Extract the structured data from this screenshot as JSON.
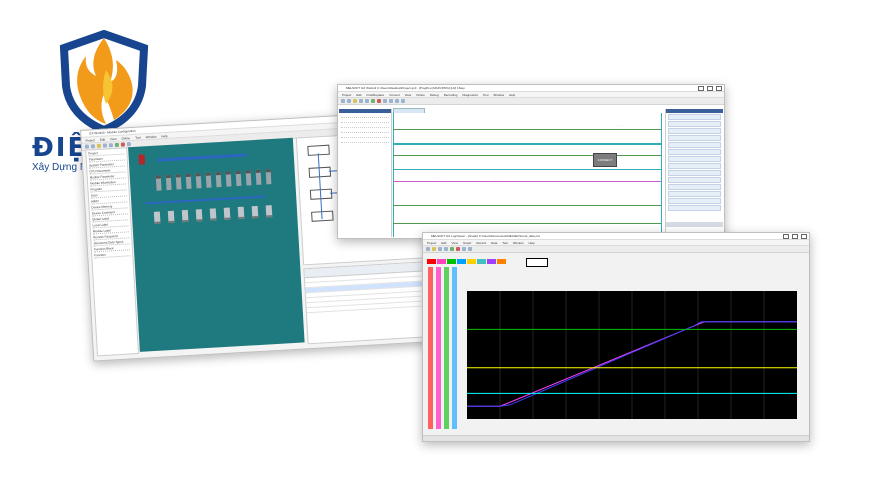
{
  "brand": {
    "name": "ĐIỆN NĂNG",
    "tagline": "Xây Dựng Niềm Tin Bằng Chất Lượng",
    "colors": {
      "blue": "#17458f",
      "flame_orange": "#f29a1a",
      "flame_yellow": "#f7c531"
    }
  },
  "windows": {
    "configurator": {
      "title": "GX Works3 - Module Configuration",
      "menu": [
        "Project",
        "Edit",
        "View",
        "Online",
        "Tool",
        "Window",
        "Help"
      ],
      "tree_items": [
        "Project",
        "Parameter",
        "System Parameter",
        "CPU Parameter",
        "Module Parameter",
        "Module Information",
        "Program",
        "Scan",
        "MAIN",
        "Device Memory",
        "Device Comment",
        "Global Label",
        "Local Label",
        "Module Label",
        "Remote Password",
        "Structured Data Types",
        "Function Block",
        "Function"
      ],
      "tab": "Module Configuration",
      "accent": "#1e7a7e"
    },
    "ladder": {
      "title": "MELSOFT GX Works3 C:\\Users\\Desktop\\Project.gx3 - [ProgPou] MAIN [PRG] [LD] 1Step",
      "menu": [
        "Project",
        "Edit",
        "Find/Replace",
        "Convert",
        "View",
        "Online",
        "Debug",
        "Recording",
        "Diagnostics",
        "Tool",
        "Window",
        "Help"
      ],
      "tabs": [
        "ProgPou [PRG] [LD]"
      ],
      "panel_navigation": "Navigation",
      "panel_elements": "Element Selection",
      "elements": [
        "Function Block",
        "Function",
        "Constant",
        "Structured Data",
        "Standard Function",
        "Standard FB",
        "Simulation",
        "Comparison",
        "Counter",
        "Timer",
        "Logical Op",
        "Data Transfer",
        "Program Control",
        "Output",
        "Special",
        "Math"
      ],
      "coil_label": "CONNECT",
      "rail_color": "#2fb0b8"
    },
    "trend": {
      "title": "MELSOFT GX LogViewer - [Graph] C:\\Users\\Documents\\MELSEC\\trend_data.csv",
      "menu": [
        "Project",
        "Edit",
        "View",
        "Graph",
        "Record",
        "Data",
        "Tool",
        "Window",
        "Help"
      ],
      "chip_colors": [
        "#ff0000",
        "#ff40c0",
        "#00c000",
        "#00a0ff",
        "#ffd000",
        "#40c0c0",
        "#a040ff",
        "#ff8000"
      ],
      "plot_bg": "#000000",
      "status": "Ready"
    }
  },
  "chart_data": {
    "type": "line",
    "title": "",
    "xlabel": "",
    "ylabel": "",
    "xlim": [
      0,
      100
    ],
    "ylim": [
      0,
      100
    ],
    "grid": true,
    "series": [
      {
        "color": "#ff40ff",
        "x": [
          0,
          10,
          12,
          70,
          72,
          100
        ],
        "y": [
          10,
          10,
          12,
          74,
          76,
          76
        ]
      },
      {
        "color": "#4040ff",
        "x": [
          0,
          10,
          13,
          69,
          71,
          100
        ],
        "y": [
          10,
          10,
          11,
          73,
          76,
          76
        ]
      },
      {
        "color": "#00c000",
        "x": [
          0,
          100
        ],
        "y": [
          70,
          70
        ]
      },
      {
        "color": "#ffff00",
        "x": [
          0,
          100
        ],
        "y": [
          40,
          40
        ]
      },
      {
        "color": "#00ffff",
        "x": [
          0,
          100
        ],
        "y": [
          20,
          20
        ]
      }
    ]
  }
}
